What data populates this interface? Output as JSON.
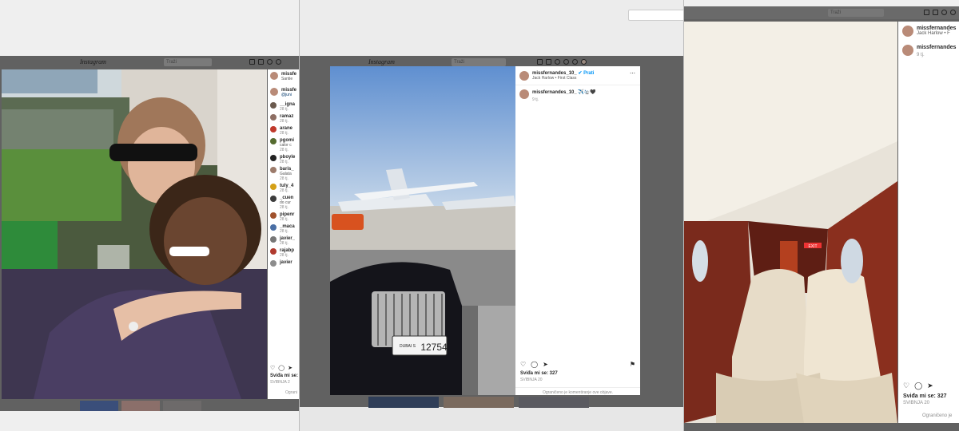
{
  "app": {
    "logo": "Instagram",
    "search_placeholder": "Traži"
  },
  "win1": {
    "header_user": "missfe",
    "header_sub": "Santie",
    "caption_user": "missfe",
    "caption_sub": "@juni",
    "comments": [
      {
        "user": "__igna",
        "text": "",
        "ago": "28 tj."
      },
      {
        "user": "ramaz",
        "text": "",
        "ago": "28 tj."
      },
      {
        "user": "arane",
        "text": "",
        "ago": "28 tj."
      },
      {
        "user": "pgomi",
        "text": "calor c",
        "ago": "28 tj."
      },
      {
        "user": "pboyle",
        "text": "",
        "ago": "28 tj."
      },
      {
        "user": "baris_",
        "text": "Galata",
        "ago": "28 tj."
      },
      {
        "user": "tuly_4",
        "text": "",
        "ago": "28 tj."
      },
      {
        "user": "_cuen",
        "text": "do cur",
        "ago": "28 tj."
      },
      {
        "user": "pipenr",
        "text": "",
        "ago": "28 tj."
      },
      {
        "user": "_maca",
        "text": "",
        "ago": "28 tj."
      },
      {
        "user": "javier_",
        "text": "",
        "ago": "28 tj."
      },
      {
        "user": "rajabp",
        "text": "",
        "ago": "28 tj."
      },
      {
        "user": "javier",
        "text": "",
        "ago": ""
      }
    ],
    "likes": "Sviđa mi se:",
    "date": "SVIBNJA 2",
    "limited": "Ograni"
  },
  "win2": {
    "header_user": "missfernandes_10_",
    "follow_label": "Prati",
    "header_sub": "Jack Harlow • First Class",
    "caption_user": "missfernandes_10_",
    "caption_emoji": "✈️🛬🖤",
    "ago": "9 tj.",
    "likes": "Sviđa mi se: 327",
    "date": "SVIBNJA 20",
    "limited": "Ograničeno je komentiranje ove objave.",
    "plate_code": "DUBAI S",
    "plate_number": "12754"
  },
  "win3": {
    "header_user": "missfernandes",
    "header_sub": "Jack Harlow • F",
    "caption_user": "missfernandes",
    "ago": "9 tj.",
    "likes": "Sviđa mi se: 327",
    "date": "SVIBNJA 20",
    "limited": "Ograničeno je",
    "exit_sign": "EXIT"
  }
}
